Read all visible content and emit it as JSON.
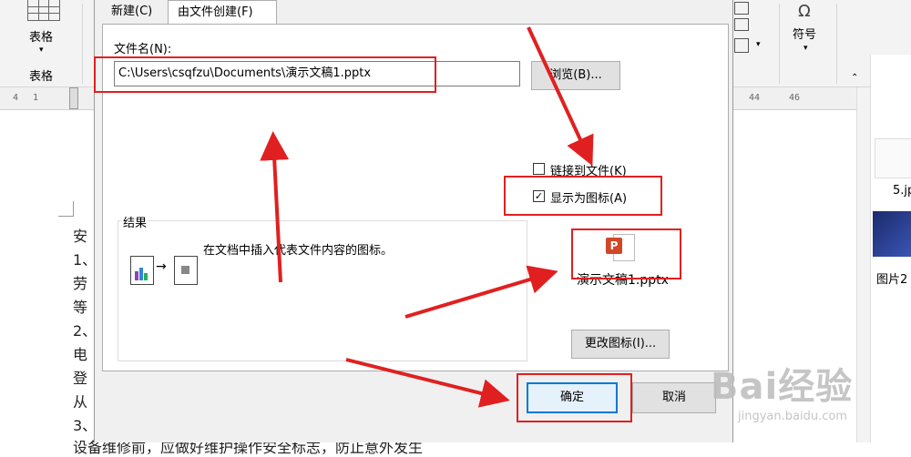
{
  "word": {
    "ribbon": {
      "table_label": "表格",
      "table_group": "表格",
      "symbol_label": "符号",
      "omega": "Ω"
    },
    "ruler": [
      "4",
      "1",
      "44",
      "46"
    ],
    "doc_lines": [
      "安",
      "1、",
      "劳",
      "等",
      "2、",
      "电",
      "登",
      "从",
      "3、"
    ],
    "bottom_text": "设备维修前，应做好维护操作安全标志，防止意外发生",
    "right_panel": {
      "thumb1_label": "5.jp",
      "thumb2_label": "图片2"
    }
  },
  "dialog": {
    "tabs": [
      "新建(C)",
      "由文件创建(F)"
    ],
    "filename_label": "文件名(N):",
    "filename_value": "C:\\Users\\csqfzu\\Documents\\演示文稿1.pptx",
    "browse_label": "浏览(B)...",
    "link_label": "链接到文件(K)",
    "link_checked": false,
    "show_icon_label": "显示为图标(A)",
    "show_icon_checked": true,
    "result_title": "结果",
    "result_text": "在文档中插入代表文件内容的图标。",
    "icon_caption": "演示文稿1.pptx",
    "change_icon_label": "更改图标(I)...",
    "ok_label": "确定",
    "cancel_label": "取消"
  },
  "watermark": {
    "brand": "Bai经验",
    "url": "jingyan.baidu.com"
  },
  "colors": {
    "annotation": "#e02020",
    "ppt_icon": "#d24726"
  }
}
